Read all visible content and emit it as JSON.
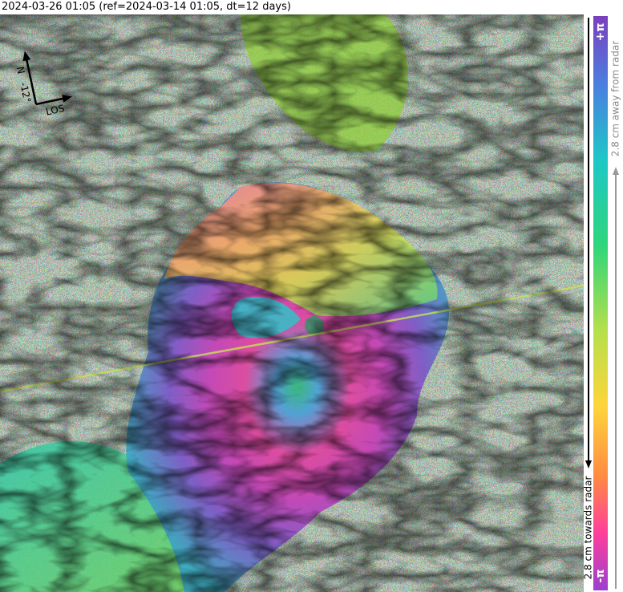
{
  "header": {
    "title": "2024-03-26 01:05 (ref=2024-03-14 01:05, dt=12 days)"
  },
  "north_arrow": {
    "north_label": "N",
    "heading": "-12°",
    "los_label": "LOS"
  },
  "colorbar": {
    "top_label": "+π",
    "bottom_label": "-π",
    "away_label": "2.8 cm away from radar",
    "towards_label": "2.8 cm towards radar",
    "colors": [
      "#7b3fbf",
      "#4a7fe0",
      "#1ec7c7",
      "#2fd67a",
      "#b7e04a",
      "#ffd43b",
      "#ff8c42",
      "#ff3f9b",
      "#9b3fcf"
    ]
  },
  "image": {
    "description_icon": "interferogram-image"
  }
}
